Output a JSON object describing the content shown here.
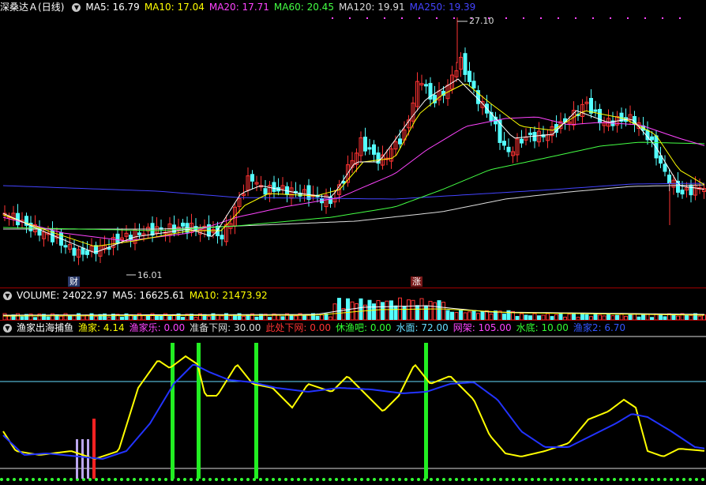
{
  "main": {
    "stock_name": "深桑达Ａ",
    "period": "(日线)",
    "ma": [
      {
        "label": "MA5: 16.79",
        "color": "#ffffff"
      },
      {
        "label": "MA10: 17.04",
        "color": "#ffff00"
      },
      {
        "label": "MA20: 17.71",
        "color": "#ff44ff"
      },
      {
        "label": "MA60: 20.45",
        "color": "#44ff44"
      },
      {
        "label": "MA120: 19.91",
        "color": "#dddddd"
      },
      {
        "label": "MA250: 19.39",
        "color": "#4444ff"
      }
    ],
    "high_label": "27.10",
    "low_label": "16.01",
    "badge_cai": "财",
    "badge_zhang": "涨"
  },
  "volume": {
    "title": "VOLUME: 24022.97",
    "ma5": "MA5: 16625.61",
    "ma10": "MA10: 21473.92"
  },
  "indicator": {
    "title": "渔家出海捕鱼",
    "items": [
      {
        "label": "渔家: 4.14",
        "color": "#ffff00"
      },
      {
        "label": "渔家乐: 0.00",
        "color": "#ff44ff"
      },
      {
        "label": "准备下网: 30.00",
        "color": "#dddddd"
      },
      {
        "label": "此处下网: 0.00",
        "color": "#ff3333"
      },
      {
        "label": "休渔吧: 0.00",
        "color": "#33ff33"
      },
      {
        "label": "水面: 72.00",
        "color": "#66ddff"
      },
      {
        "label": "网架: 105.00",
        "color": "#ff44ff"
      },
      {
        "label": "水底: 10.00",
        "color": "#33ff33"
      },
      {
        "label": "渔家2: 6.70",
        "color": "#3355ff"
      }
    ]
  },
  "colors": {
    "up": "#ff3333",
    "down": "#54ffff",
    "grid_sep": "#a00000"
  }
}
